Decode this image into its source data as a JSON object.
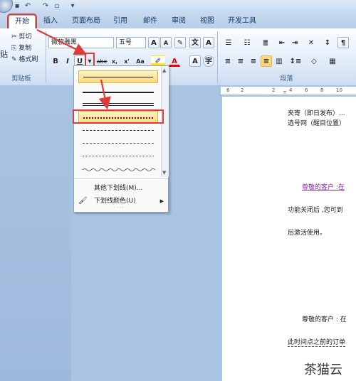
{
  "quick_access": {
    "undo": "↶",
    "redo": "↷"
  },
  "tabs": [
    {
      "label": "开始",
      "active": true
    },
    {
      "label": "插入"
    },
    {
      "label": "页面布局"
    },
    {
      "label": "引用"
    },
    {
      "label": "邮件"
    },
    {
      "label": "审阅"
    },
    {
      "label": "视图"
    },
    {
      "label": "开发工具"
    }
  ],
  "clipboard": {
    "cut": "剪切",
    "copy": "复制",
    "painter": "格式刷",
    "paste": "贴",
    "group_label": "剪贴板"
  },
  "font": {
    "name": "微软雅黑",
    "size": "五号",
    "grow": "A",
    "shrink": "A",
    "bold": "B",
    "italic": "I",
    "underline": "U",
    "strike": "abe",
    "subscript": "x,",
    "superscript": "x'",
    "case": "Aa",
    "font_color": "A"
  },
  "paragraph": {
    "group_label": "段落"
  },
  "ruler_numbers": [
    "6",
    "2",
    "2",
    "4",
    "6",
    "8",
    "10"
  ],
  "document": {
    "line1": "夹寄（即日发布）...",
    "line2": "选号网（醒目位置）",
    "notice1": "尊敬的客户 :在",
    "line3": "功能关闭后 ,您可到",
    "line4": "后激活使用。",
    "notice2": "尊敬的客户 : 在",
    "line5": "此时间点之前的订单"
  },
  "dropdown": {
    "more_underlines": "其他下划线(M)...",
    "underline_color": "下划线颜色(U)",
    "more_dots": "· · · ·"
  },
  "watermark": "茶猫云",
  "colors": {
    "accent_red": "#e23a3a",
    "highlight": "#ffd97a",
    "notice": "#8a2aa8"
  }
}
